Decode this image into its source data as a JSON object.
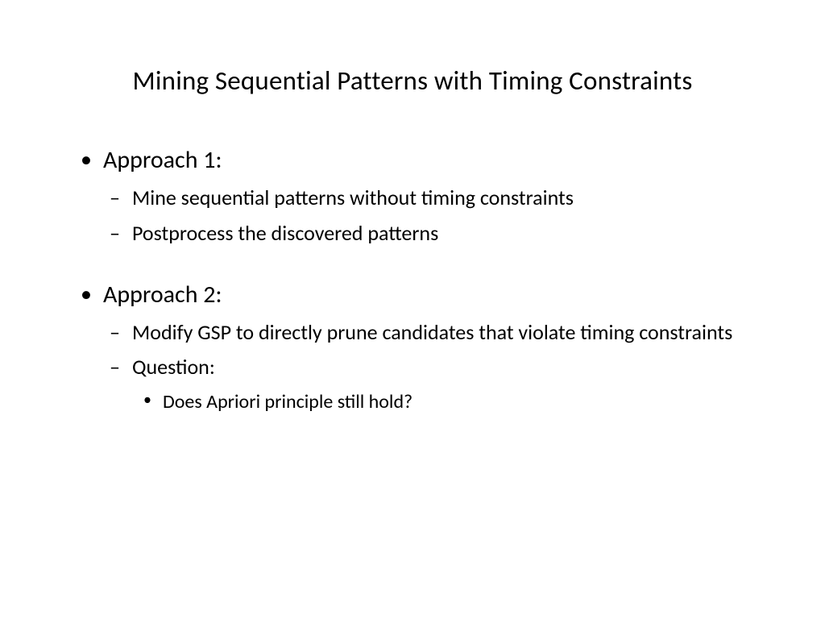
{
  "slide": {
    "title": "Mining Sequential Patterns with Timing Constraints",
    "bullets": {
      "approach1": {
        "label": "Approach 1:",
        "sub1": "Mine sequential patterns without timing constraints",
        "sub2": "Postprocess the discovered patterns"
      },
      "approach2": {
        "label": "Approach 2:",
        "sub1": "Modify GSP to directly prune candidates that violate timing constraints",
        "sub2": "Question:",
        "sub2_sub1": "Does Apriori principle still hold?"
      }
    }
  }
}
